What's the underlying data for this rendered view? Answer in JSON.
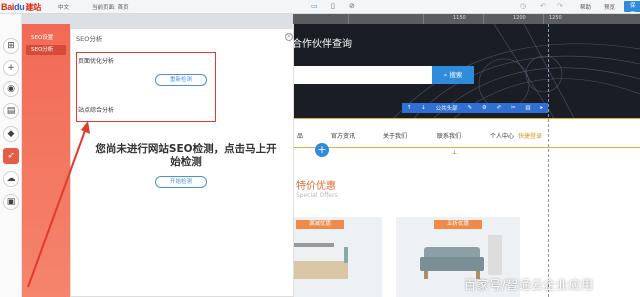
{
  "topbar": {
    "logo_a": "Bai",
    "logo_b": "du",
    "logo_c": "建站",
    "lang": "中文",
    "current_page": "当前页面: 首页",
    "help": "帮助",
    "preview": "预览",
    "save": "保存"
  },
  "ruler": {
    "labels": [
      "1150",
      "1200",
      "1250"
    ]
  },
  "seo_nav": {
    "items": [
      {
        "label": "SEO设置"
      },
      {
        "label": "SEO分析"
      }
    ]
  },
  "panel": {
    "title": "SEO分析",
    "section_page": "页面优化分析",
    "recheck": "重新检测",
    "section_site": "站点综合分析",
    "message": "您尚未进行网站SEO检测，点击马上开始检测",
    "start": "开始检测"
  },
  "site": {
    "hero_title": "合作伙伴查询",
    "search_button": "搜索",
    "toolbar_label": "公共头部",
    "nav": [
      "品",
      "官方资讯",
      "关于我们",
      "联系我们",
      "个人中心"
    ],
    "nav_highlight": "快捷登录",
    "section_title": "特价优惠",
    "section_subtitle": "Special Offers",
    "card_tags": [
      "满减优惠",
      "五折优惠"
    ],
    "watermark": "百家号/智通云企业应用"
  },
  "colors": {
    "accent": "#2f8bdc",
    "seo_orange": "#f26a55",
    "highlight": "#e33a2c"
  }
}
